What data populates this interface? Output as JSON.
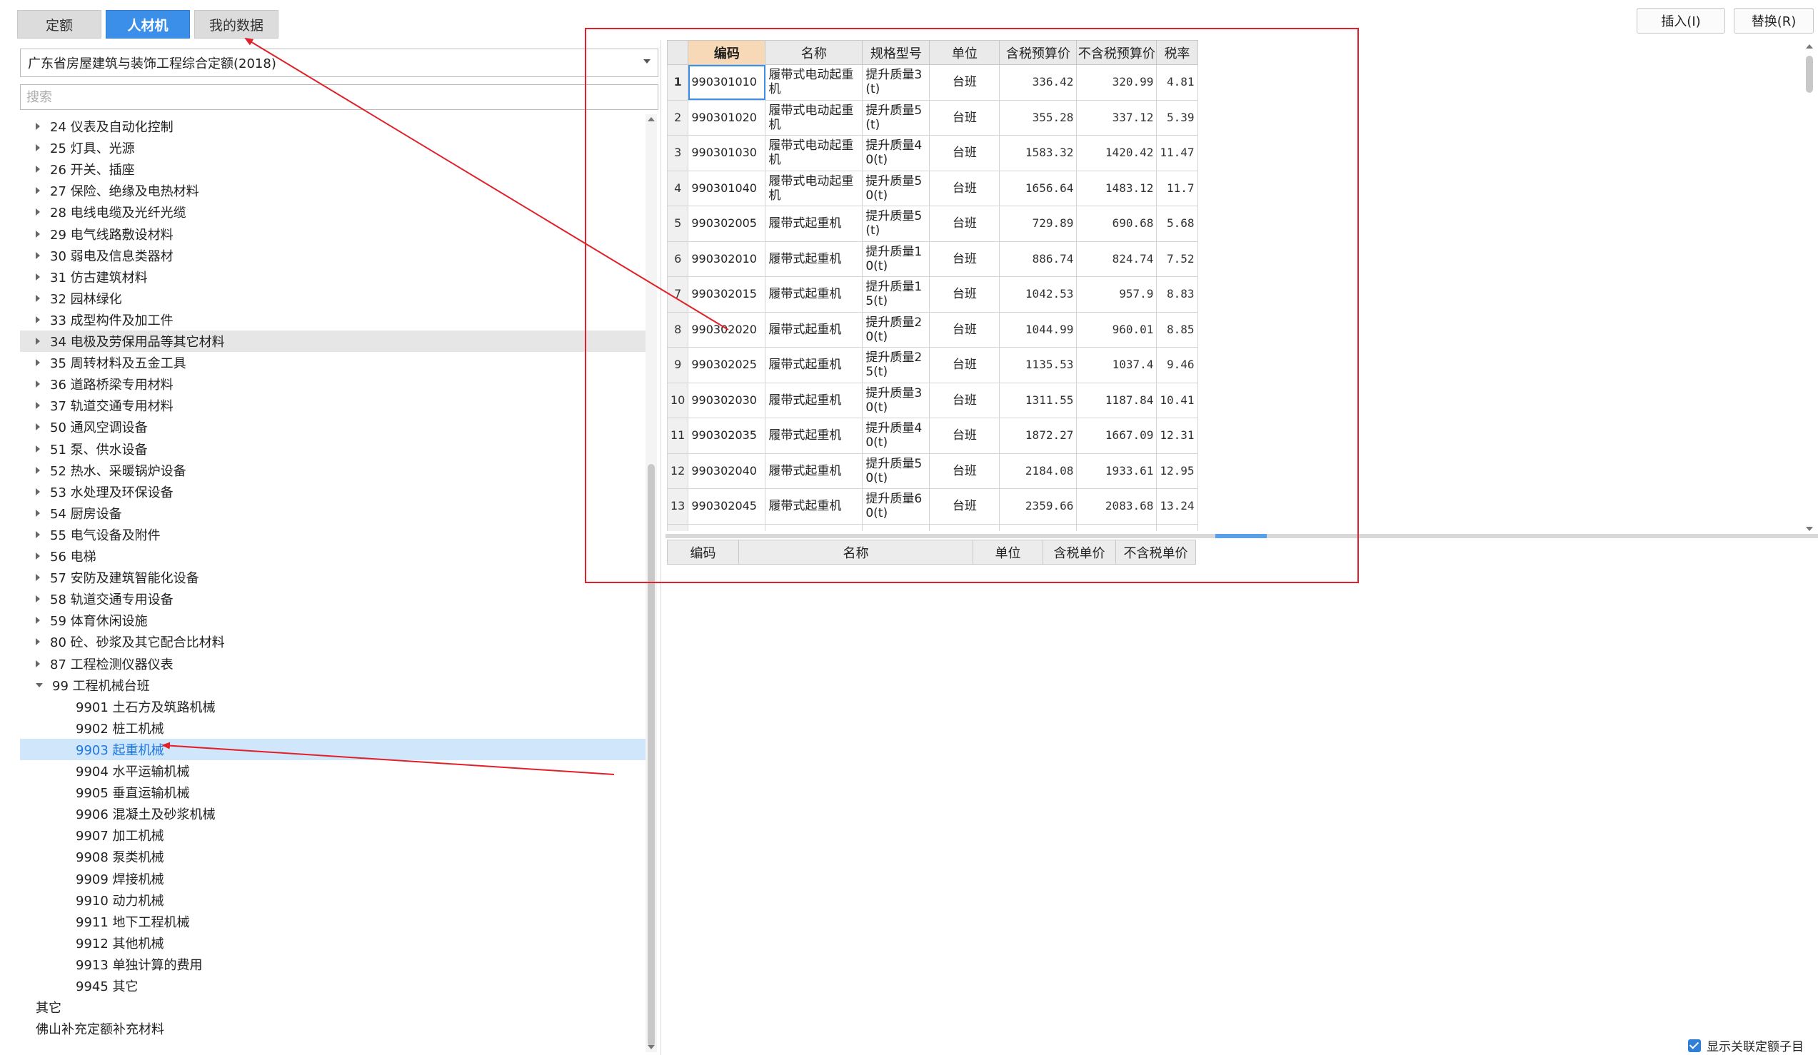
{
  "tabs": [
    "定额",
    "人材机",
    "我的数据"
  ],
  "toolbar": {
    "insert_label": "插入(I)",
    "replace_label": "替换(R)"
  },
  "left": {
    "dropdown_value": "广东省房屋建筑与装饰工程综合定额(2018)",
    "search_placeholder": "搜索",
    "tree": [
      {
        "label": "24 仪表及自动化控制"
      },
      {
        "label": "25 灯具、光源"
      },
      {
        "label": "26 开关、插座"
      },
      {
        "label": "27 保险、绝缘及电热材料"
      },
      {
        "label": "28 电线电缆及光纤光缆"
      },
      {
        "label": "29 电气线路敷设材料"
      },
      {
        "label": "30 弱电及信息类器材"
      },
      {
        "label": "31 仿古建筑材料"
      },
      {
        "label": "32 园林绿化"
      },
      {
        "label": "33 成型构件及加工件"
      },
      {
        "label": "34 电极及劳保用品等其它材料"
      },
      {
        "label": "35 周转材料及五金工具"
      },
      {
        "label": "36 道路桥梁专用材料"
      },
      {
        "label": "37 轨道交通专用材料"
      },
      {
        "label": "50 通风空调设备"
      },
      {
        "label": "51 泵、供水设备"
      },
      {
        "label": "52 热水、采暖锅炉设备"
      },
      {
        "label": "53 水处理及环保设备"
      },
      {
        "label": "54 厨房设备"
      },
      {
        "label": "55 电气设备及附件"
      },
      {
        "label": "56 电梯"
      },
      {
        "label": "57 安防及建筑智能化设备"
      },
      {
        "label": "58 轨道交通专用设备"
      },
      {
        "label": "59 体育休闲设施"
      },
      {
        "label": "80 砼、砂浆及其它配合比材料"
      },
      {
        "label": "87 工程检测仪器仪表"
      },
      {
        "label": "99 工程机械台班"
      },
      {
        "label": "9901 土石方及筑路机械"
      },
      {
        "label": "9902 桩工机械"
      },
      {
        "label": "9903 起重机械"
      },
      {
        "label": "9904 水平运输机械"
      },
      {
        "label": "9905 垂直运输机械"
      },
      {
        "label": "9906 混凝土及砂浆机械"
      },
      {
        "label": "9907 加工机械"
      },
      {
        "label": "9908 泵类机械"
      },
      {
        "label": "9909 焊接机械"
      },
      {
        "label": "9910 动力机械"
      },
      {
        "label": "9911 地下工程机械"
      },
      {
        "label": "9912 其他机械"
      },
      {
        "label": "9913 单独计算的费用"
      },
      {
        "label": "9945 其它"
      },
      {
        "label": "其它"
      },
      {
        "label": "佛山补充定额补充材料"
      }
    ]
  },
  "grid": {
    "headers": [
      "编码",
      "名称",
      "规格型号",
      "单位",
      "含税预算价",
      "不含税预算价",
      "税率"
    ],
    "rows": [
      {
        "idx": "1",
        "code": "990301010",
        "name": "履带式电动起重机",
        "spec": "提升质量3(t)",
        "unit": "台班",
        "price_tax": "336.42",
        "price_notax": "320.99",
        "rate": "4.81"
      },
      {
        "idx": "2",
        "code": "990301020",
        "name": "履带式电动起重机",
        "spec": "提升质量5(t)",
        "unit": "台班",
        "price_tax": "355.28",
        "price_notax": "337.12",
        "rate": "5.39"
      },
      {
        "idx": "3",
        "code": "990301030",
        "name": "履带式电动起重机",
        "spec": "提升质量40(t)",
        "unit": "台班",
        "price_tax": "1583.32",
        "price_notax": "1420.42",
        "rate": "11.47"
      },
      {
        "idx": "4",
        "code": "990301040",
        "name": "履带式电动起重机",
        "spec": "提升质量50(t)",
        "unit": "台班",
        "price_tax": "1656.64",
        "price_notax": "1483.12",
        "rate": "11.7"
      },
      {
        "idx": "5",
        "code": "990302005",
        "name": "履带式起重机",
        "spec": "提升质量5(t)",
        "unit": "台班",
        "price_tax": "729.89",
        "price_notax": "690.68",
        "rate": "5.68"
      },
      {
        "idx": "6",
        "code": "990302010",
        "name": "履带式起重机",
        "spec": "提升质量10(t)",
        "unit": "台班",
        "price_tax": "886.74",
        "price_notax": "824.74",
        "rate": "7.52"
      },
      {
        "idx": "7",
        "code": "990302015",
        "name": "履带式起重机",
        "spec": "提升质量15(t)",
        "unit": "台班",
        "price_tax": "1042.53",
        "price_notax": "957.9",
        "rate": "8.83"
      },
      {
        "idx": "8",
        "code": "990302020",
        "name": "履带式起重机",
        "spec": "提升质量20(t)",
        "unit": "台班",
        "price_tax": "1044.99",
        "price_notax": "960.01",
        "rate": "8.85"
      },
      {
        "idx": "9",
        "code": "990302025",
        "name": "履带式起重机",
        "spec": "提升质量25(t)",
        "unit": "台班",
        "price_tax": "1135.53",
        "price_notax": "1037.4",
        "rate": "9.46"
      },
      {
        "idx": "10",
        "code": "990302030",
        "name": "履带式起重机",
        "spec": "提升质量30(t)",
        "unit": "台班",
        "price_tax": "1311.55",
        "price_notax": "1187.84",
        "rate": "10.41"
      },
      {
        "idx": "11",
        "code": "990302035",
        "name": "履带式起重机",
        "spec": "提升质量40(t)",
        "unit": "台班",
        "price_tax": "1872.27",
        "price_notax": "1667.09",
        "rate": "12.31"
      },
      {
        "idx": "12",
        "code": "990302040",
        "name": "履带式起重机",
        "spec": "提升质量50(t)",
        "unit": "台班",
        "price_tax": "2184.08",
        "price_notax": "1933.61",
        "rate": "12.95"
      },
      {
        "idx": "13",
        "code": "990302045",
        "name": "履带式起重机",
        "spec": "提升质量60(t)",
        "unit": "台班",
        "price_tax": "2359.66",
        "price_notax": "2083.68",
        "rate": "13.24"
      },
      {
        "idx": "",
        "code": "",
        "name": "",
        "spec": "提升质量",
        "unit": "",
        "price_tax": "",
        "price_notax": "",
        "rate": ""
      }
    ]
  },
  "lower_grid": {
    "headers": [
      "编码",
      "名称",
      "单位",
      "含税单价",
      "不含税单价"
    ]
  },
  "footer": {
    "show_related_label": "显示关联定额子目"
  },
  "colors": {
    "accent": "#3c8fe8",
    "annotation": "#e0202a",
    "active_header": "#f7d9b7",
    "selected_row": "#cfe6fb"
  }
}
